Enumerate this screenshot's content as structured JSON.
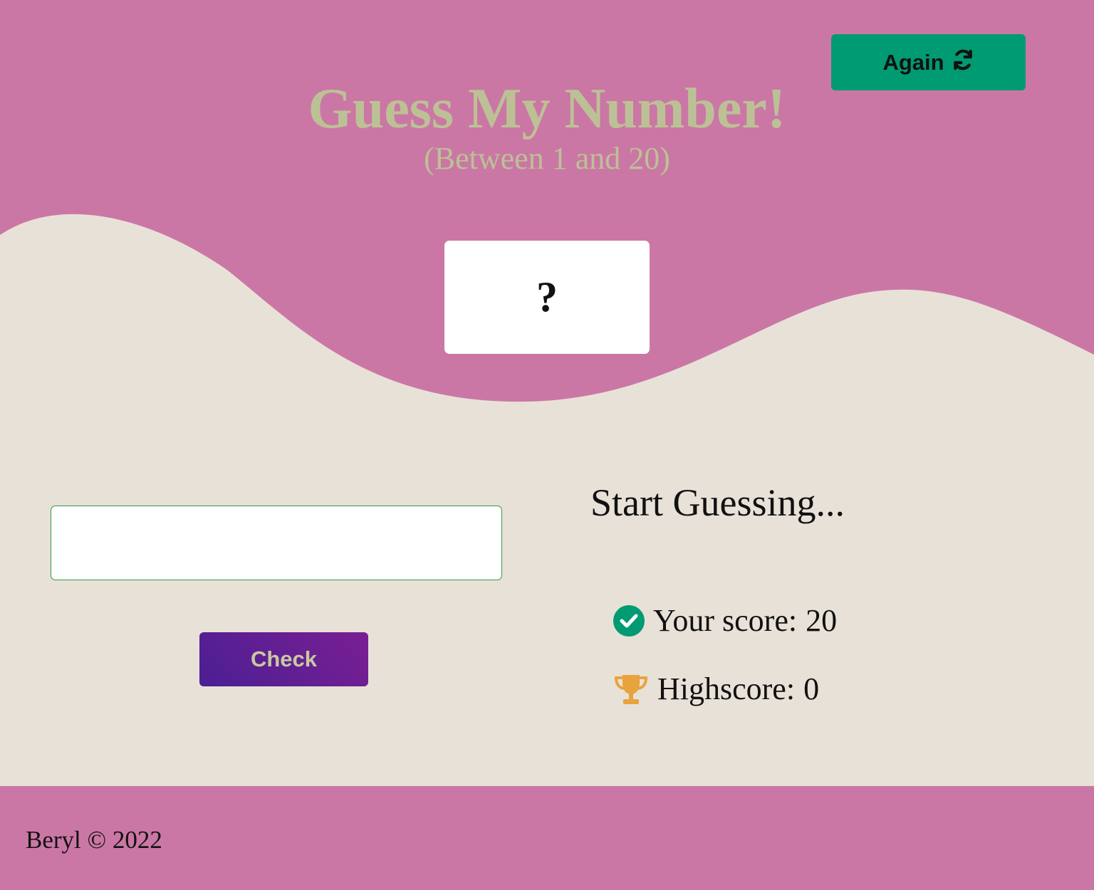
{
  "header": {
    "again_label": "Again",
    "title": "Guess My Number!",
    "subtitle": "(Between 1 and 20)",
    "secret_number": "?"
  },
  "controls": {
    "guess_value": "",
    "check_label": "Check"
  },
  "status": {
    "message": "Start Guessing...",
    "score_label": "Your score:",
    "score_value": "20",
    "highscore_label": "Highscore:",
    "highscore_value": "0"
  },
  "icons": {
    "again": "refresh-icon",
    "score": "check-circle-icon",
    "highscore": "trophy-icon"
  },
  "footer": {
    "text": "Beryl © 2022"
  },
  "colors": {
    "header_background": "#cb77a5",
    "page_background": "#e8e1d8",
    "title_text": "#bcc195",
    "again_button": "#009b72",
    "check_button": "#5b1f93",
    "score_icon": "#009b72",
    "trophy_icon": "#e8a33c"
  }
}
